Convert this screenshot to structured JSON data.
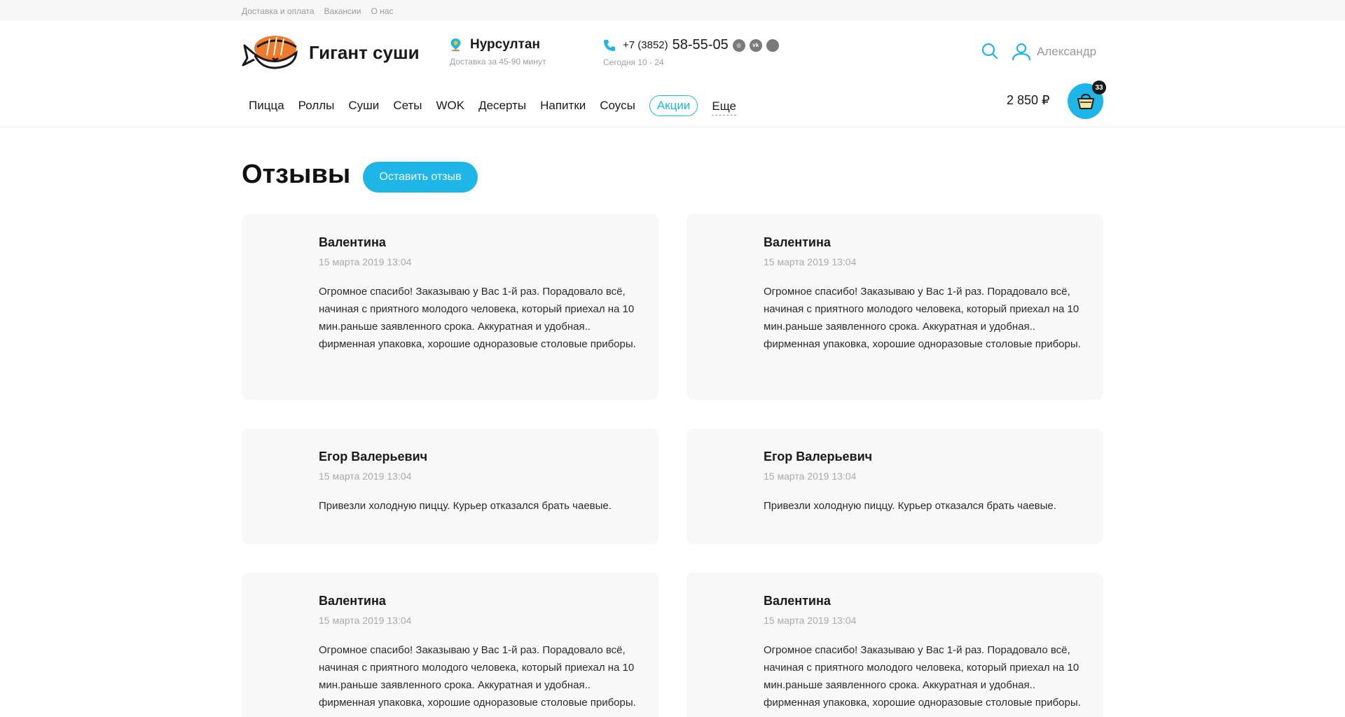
{
  "topbar": {
    "links": [
      "Доставка и оплата",
      "Вакансии",
      "О нас"
    ]
  },
  "brand": {
    "name": "Гигант суши"
  },
  "location": {
    "city": "Нурсултан",
    "delivery": "Доставка за 45-90 минут"
  },
  "contact": {
    "prefix": "+7 (3852)",
    "number": "58-55-05",
    "hours": "Сегодня 10 - 24"
  },
  "user": {
    "name": "Александр"
  },
  "nav": {
    "items": [
      "Пицца",
      "Роллы",
      "Суши",
      "Сеты",
      "WOK",
      "Десерты",
      "Напитки",
      "Соусы"
    ],
    "promo": "Акции",
    "more": "Еще"
  },
  "cart": {
    "total": "2 850 ₽",
    "count": "33"
  },
  "page": {
    "title": "Отзывы",
    "leave_review": "Оставить отзыв"
  },
  "reviews": [
    {
      "author": "Валентина",
      "date": "15 марта 2019 13:04",
      "text": "Огромное спасибо! Заказываю у Вас 1-й раз. Порадовало всё, начиная с приятного молодого человека, который приехал на 10 мин.раньше заявленного срока. Аккуратная и удобная.. фирменная упаковка, хорошие одноразовые столовые приборы."
    },
    {
      "author": "Валентина",
      "date": "15 марта 2019 13:04",
      "text": "Огромное спасибо! Заказываю у Вас 1-й раз. Порадовало всё, начиная с приятного молодого человека, который приехал на 10 мин.раньше заявленного срока. Аккуратная и удобная.. фирменная упаковка, хорошие одноразовые столовые приборы."
    },
    {
      "author": "Егор Валерьевич",
      "date": "15 марта 2019 13:04",
      "text": "Привезли холодную пиццу. Курьер отказался брать чаевые."
    },
    {
      "author": "Егор Валерьевич",
      "date": "15 марта 2019 13:04",
      "text": "Привезли холодную пиццу. Курьер отказался брать чаевые."
    },
    {
      "author": "Валентина",
      "date": "15 марта 2019 13:04",
      "text": "Огромное спасибо! Заказываю у Вас 1-й раз. Порадовало всё, начиная с приятного молодого человека, который приехал на 10 мин.раньше заявленного срока. Аккуратная и удобная.. фирменная упаковка, хорошие одноразовые столовые приборы."
    },
    {
      "author": "Валентина",
      "date": "15 марта 2019 13:04",
      "text": "Огромное спасибо! Заказываю у Вас 1-й раз. Порадовало всё, начиная с приятного молодого человека, который приехал на 10 мин.раньше заявленного срока. Аккуратная и удобная.. фирменная упаковка, хорошие одноразовые столовые приборы."
    }
  ],
  "colors": {
    "accent": "#1eb6e9",
    "logo_orange": "#f07a2b",
    "card_bg": "#f8f8f8"
  },
  "icons": {
    "location": "location-pin-icon",
    "phone": "phone-icon",
    "search": "search-icon",
    "user": "user-icon",
    "cart": "basket-icon",
    "social": [
      "instagram-icon",
      "vk-icon",
      "more-social-icon"
    ]
  }
}
